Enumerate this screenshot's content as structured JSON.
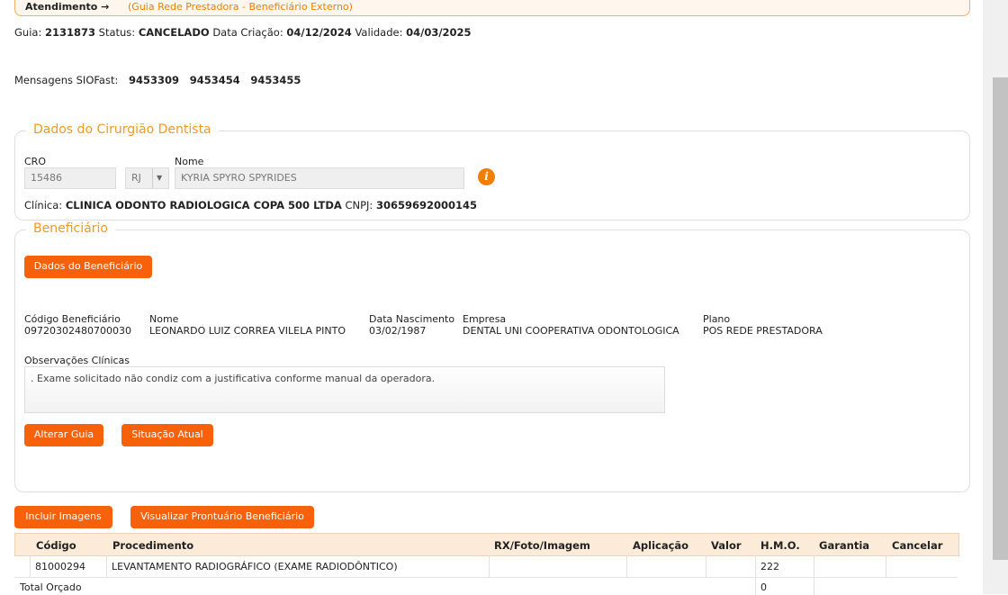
{
  "breadcrumb": {
    "title": "Atendimento →",
    "subtitle": "(Guia Rede Prestadora - Beneficiário Externo)"
  },
  "guia": {
    "label_guia": "Guia:",
    "guia": "2131873",
    "label_status": "Status:",
    "status": "CANCELADO",
    "label_data": "Data Criação:",
    "data_criacao": "04/12/2024",
    "label_validade": "Validade:",
    "validade": "04/03/2025"
  },
  "mensagens": {
    "label": "Mensagens SIOFast:",
    "items": [
      "9453309",
      "9453454",
      "9453455"
    ]
  },
  "dentista": {
    "legend": "Dados do Cirurgião Dentista",
    "cro_label": "CRO",
    "cro": "15486",
    "uf": "RJ",
    "nome_label": "Nome",
    "nome": "KYRIA SPYRO SPYRIDES",
    "clinica_label": "Clínica:",
    "clinica": "CLINICA ODONTO RADIOLOGICA COPA 500 LTDA",
    "cnpj_label": "CNPJ:",
    "cnpj": "30659692000145"
  },
  "beneficiario": {
    "legend": "Beneficiário",
    "dados_btn": "Dados do Beneficiário",
    "cols": [
      {
        "label": "Código Beneficiário",
        "value": "09720302480700030"
      },
      {
        "label": "Nome",
        "value": "LEONARDO LUIZ CORREA VILELA PINTO"
      },
      {
        "label": "Data Nascimento",
        "value": "03/02/1987"
      },
      {
        "label": "Empresa",
        "value": "DENTAL UNI COOPERATIVA ODONTOLOGICA"
      },
      {
        "label": "Plano",
        "value": "POS REDE PRESTADORA"
      }
    ],
    "obs_label": "Observações Clínicas",
    "obs": ". Exame solicitado não condiz com a justificativa conforme manual da operadora.",
    "alterar_btn": "Alterar Guia",
    "situacao_btn": "Situação Atual"
  },
  "actions": {
    "incluir": "Incluir Imagens",
    "visualizar": "Visualizar Prontuário Beneficiário"
  },
  "table": {
    "headers": [
      "Código",
      "Procedimento",
      "RX/Foto/Imagem",
      "Aplicação",
      "Valor",
      "H.M.O.",
      "Garantia",
      "Cancelar"
    ],
    "rows": [
      {
        "codigo": "81000294",
        "procedimento": "LEVANTAMENTO RADIOGRÁFICO (EXAME RADIODÔNTICO)",
        "rx": "",
        "aplicacao": "",
        "valor": "",
        "hmo": "222",
        "garantia": "",
        "cancelar": ""
      }
    ],
    "total_label": "Total Orçado",
    "total_hmo": "0"
  },
  "colors": {
    "accent": "#f6610a",
    "legend": "#f39a1f",
    "table_header": "#fcebd8"
  }
}
